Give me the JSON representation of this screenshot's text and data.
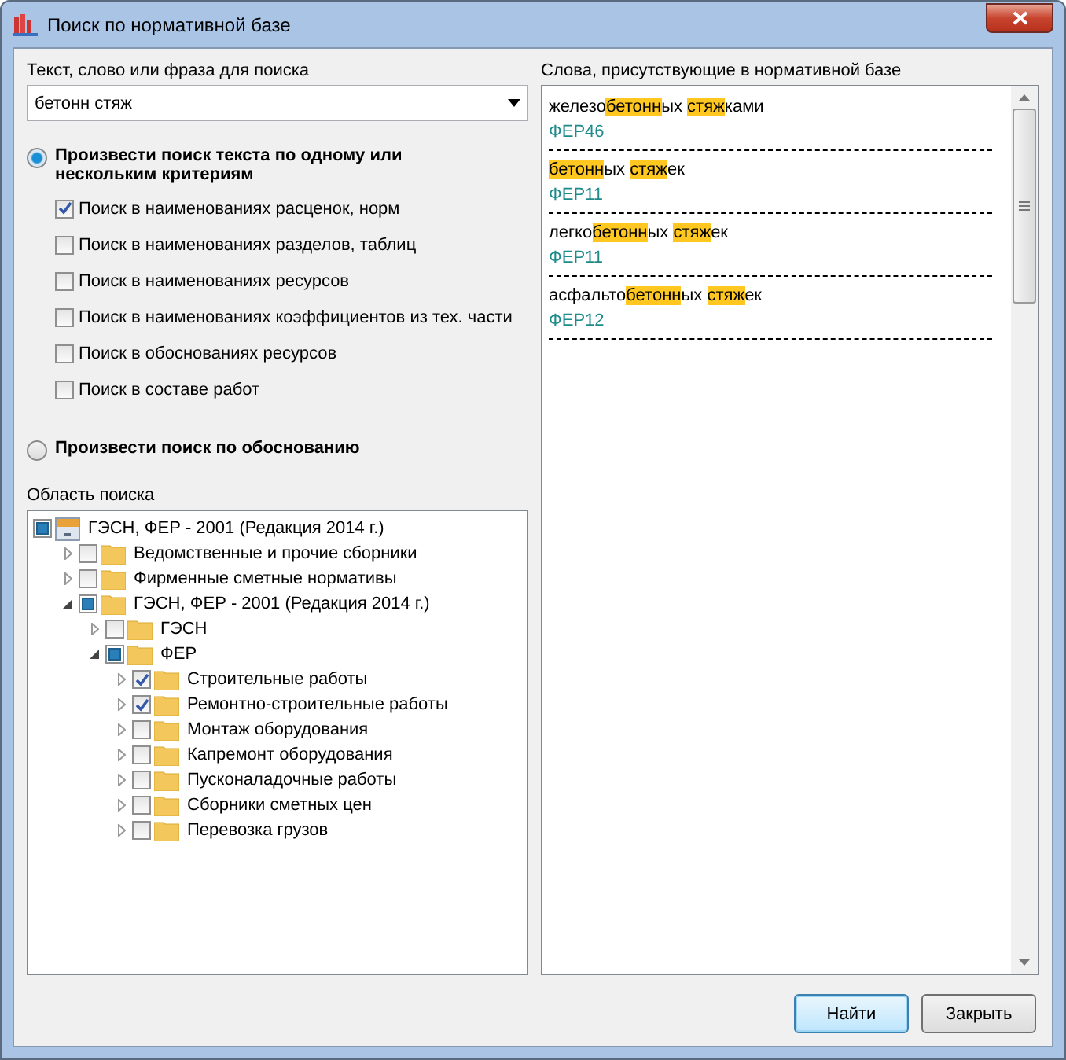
{
  "window": {
    "title": "Поиск по нормативной базе"
  },
  "search": {
    "label": "Текст, слово или фраза для поиска",
    "value": "бетонн стяж"
  },
  "modes": [
    {
      "label": "Произвести поиск текста по одному или нескольким критериям",
      "selected": true
    },
    {
      "label": "Произвести поиск по обоснованию",
      "selected": false
    }
  ],
  "criteria": [
    {
      "label": "Поиск в наименованиях расценок, норм",
      "checked": true
    },
    {
      "label": "Поиск в наименованиях разделов, таблиц",
      "checked": false
    },
    {
      "label": "Поиск в наименованиях ресурсов",
      "checked": false
    },
    {
      "label": "Поиск в наименованиях коэффициентов из тех. части",
      "checked": false
    },
    {
      "label": "Поиск в обоснованиях ресурсов",
      "checked": false
    },
    {
      "label": "Поиск в составе работ",
      "checked": false
    }
  ],
  "scope": {
    "label": "Область поиска",
    "tree": [
      {
        "label": "ГЭСН, ФЕР - 2001 (Редакция 2014 г.)",
        "kind": "database",
        "checked": false,
        "partial": true,
        "children": [
          {
            "label": "Ведомственные и прочие сборники",
            "kind": "folder",
            "checked": false,
            "partial": false,
            "expanded": false
          },
          {
            "label": "Фирменные сметные нормативы",
            "kind": "folder",
            "checked": false,
            "partial": false,
            "expanded": false
          },
          {
            "label": "ГЭСН, ФЕР - 2001 (Редакция 2014 г.)",
            "kind": "folder",
            "checked": false,
            "partial": true,
            "expanded": true,
            "children": [
              {
                "label": "ГЭСН",
                "kind": "folder",
                "checked": false,
                "partial": false,
                "expanded": false
              },
              {
                "label": "ФЕР",
                "kind": "folder",
                "checked": false,
                "partial": true,
                "expanded": true,
                "children": [
                  {
                    "label": "Строительные работы",
                    "kind": "folder",
                    "checked": true,
                    "expanded": false
                  },
                  {
                    "label": "Ремонтно-строительные работы",
                    "kind": "folder",
                    "checked": true,
                    "expanded": false
                  },
                  {
                    "label": "Монтаж оборудования",
                    "kind": "folder",
                    "checked": false,
                    "partial": false,
                    "expanded": false
                  },
                  {
                    "label": "Капремонт оборудования",
                    "kind": "folder",
                    "checked": false,
                    "partial": false,
                    "expanded": false
                  },
                  {
                    "label": "Пусконаладочные работы",
                    "kind": "folder",
                    "checked": false,
                    "partial": false,
                    "expanded": false
                  },
                  {
                    "label": "Сборники сметных цен",
                    "kind": "folder",
                    "checked": false,
                    "partial": false,
                    "expanded": false
                  },
                  {
                    "label": "Перевозка грузов",
                    "kind": "folder",
                    "checked": false,
                    "partial": false,
                    "expanded": false
                  }
                ]
              }
            ]
          }
        ]
      }
    ]
  },
  "results": {
    "label": "Слова, присутствующие в нормативной базе",
    "items": [
      {
        "parts": [
          {
            "text": "железо",
            "highlight": false
          },
          {
            "text": "бетонн",
            "highlight": true
          },
          {
            "text": "ых ",
            "highlight": false
          },
          {
            "text": "стяж",
            "highlight": true
          },
          {
            "text": "ками",
            "highlight": false
          }
        ],
        "source": "ФЕР46"
      },
      {
        "parts": [
          {
            "text": "бетонн",
            "highlight": true
          },
          {
            "text": "ых ",
            "highlight": false
          },
          {
            "text": "стяж",
            "highlight": true
          },
          {
            "text": "ек",
            "highlight": false
          }
        ],
        "source": "ФЕР11"
      },
      {
        "parts": [
          {
            "text": "легко",
            "highlight": false
          },
          {
            "text": "бетонн",
            "highlight": true
          },
          {
            "text": "ых ",
            "highlight": false
          },
          {
            "text": "стяж",
            "highlight": true
          },
          {
            "text": "ек",
            "highlight": false
          }
        ],
        "source": "ФЕР11"
      },
      {
        "parts": [
          {
            "text": "асфальто",
            "highlight": false
          },
          {
            "text": "бетонн",
            "highlight": true
          },
          {
            "text": "ых ",
            "highlight": false
          },
          {
            "text": "стяж",
            "highlight": true
          },
          {
            "text": "ек",
            "highlight": false
          }
        ],
        "source": "ФЕР12"
      }
    ]
  },
  "buttons": [
    {
      "label": "Найти",
      "kind": "default"
    },
    {
      "label": "Закрыть",
      "kind": "normal"
    }
  ]
}
